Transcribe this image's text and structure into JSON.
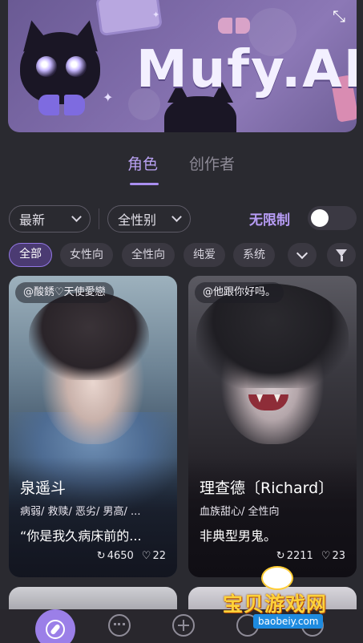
{
  "banner": {
    "logo_text": "Mufy.AI"
  },
  "tabs": {
    "active": "角色",
    "inactive": "创作者"
  },
  "filters": {
    "sort_value": "最新",
    "gender_value": "全性别",
    "unlimited_label": "无限制",
    "unlimited_on": false,
    "accent_color": "#b79cf5"
  },
  "chips": {
    "items": [
      "全部",
      "女性向",
      "全性向",
      "纯爱",
      "系统"
    ],
    "active_index": 0
  },
  "cards": [
    {
      "creator": "@酸銹♡天使愛戀",
      "name": "泉遥斗",
      "tags": "病弱/ 救赎/ 恶劣/ 男高/ ...",
      "desc": "“你是我久病床前的...",
      "replies": "4650",
      "likes": "22"
    },
    {
      "creator": "@他跟你好吗。",
      "name": "理查德〔Richard〕",
      "tags": "血族甜心/ 全性向",
      "desc": "非典型男鬼。",
      "replies": "2211",
      "likes": "23"
    }
  ],
  "watermark": {
    "text": "宝贝游戏网",
    "url": "baobeiy.com"
  },
  "icons": {
    "expand": "expand-icon",
    "explore": "compass-icon",
    "chat": "chat-bubble-icon",
    "create": "plus-circle-icon",
    "filter": "funnel-icon",
    "more": "chevron-down-icon"
  }
}
